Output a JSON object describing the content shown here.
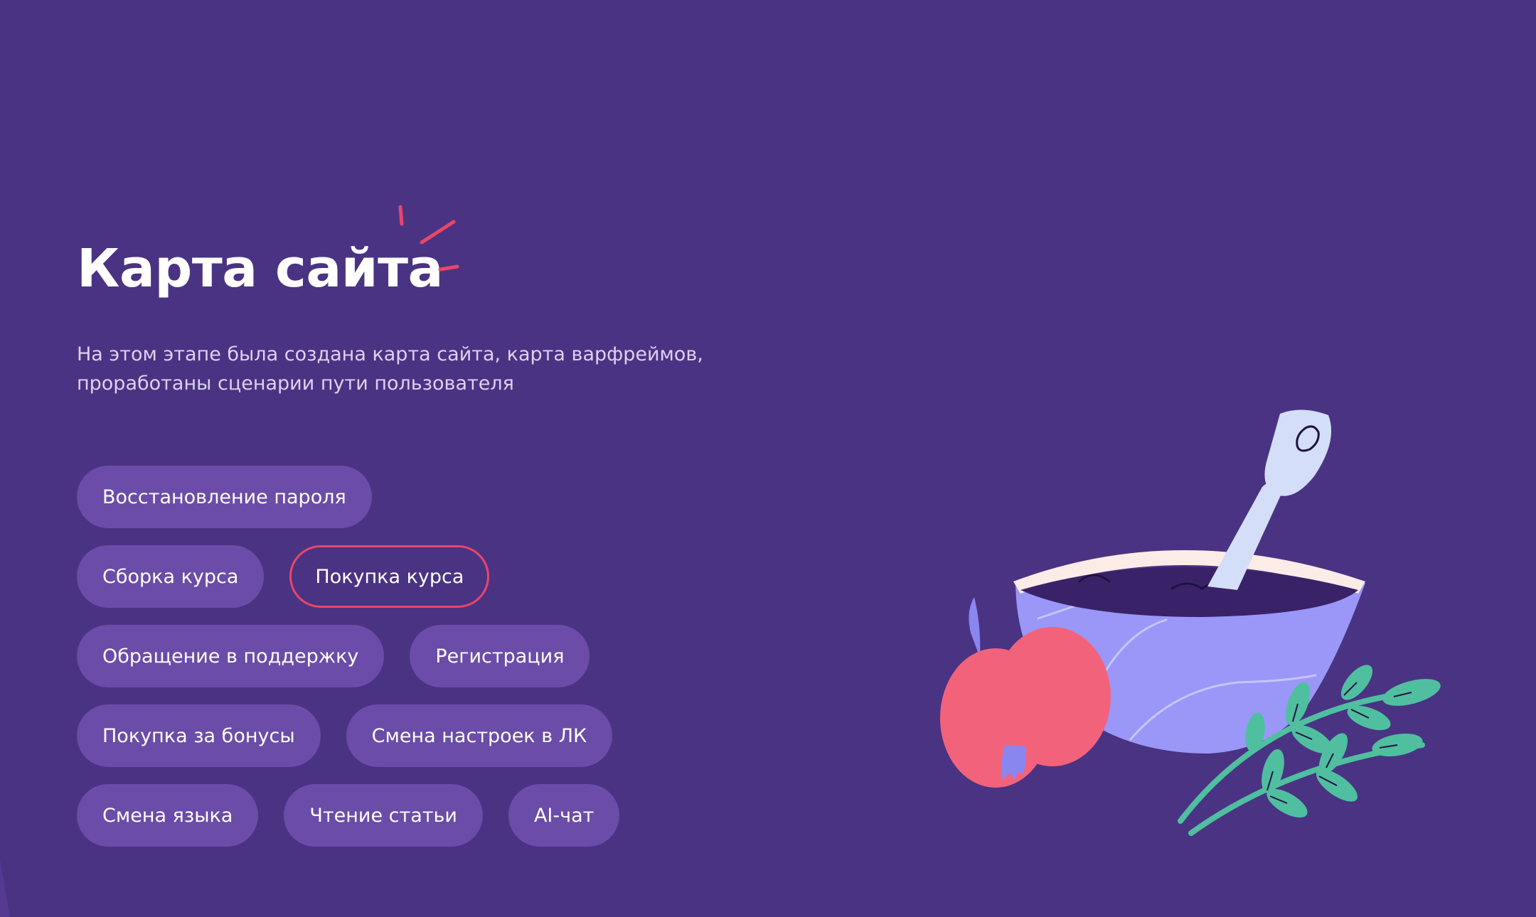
{
  "section": {
    "title": "Карта сайта",
    "description_lines": [
      "На этом этапе была создана карта сайта, карта варфреймов,",
      "проработаны сценарии пути пользователя"
    ]
  },
  "chips": [
    [
      "Восстановление пароля"
    ],
    [
      "Сборка курса",
      "Покупка курса"
    ],
    [
      "Обращение в поддержку",
      "Регистрация"
    ],
    [
      "Покупка за бонусы",
      "Смена настроек в ЛК"
    ],
    [
      "Смена языка",
      "Чтение статьи",
      "AI-чат"
    ]
  ],
  "selected_chip": "Покупка курса",
  "colors": {
    "background": "#4a3383",
    "chip": "#6b4ca8",
    "accent": "#e8466a",
    "bowl": "#9a97f8",
    "apple": "#f2637b",
    "leaves": "#4fbfa0"
  },
  "icons": {
    "sparkle": "sparkle-lines-icon",
    "illustration": "porridge-bowl-apple-leaves"
  }
}
